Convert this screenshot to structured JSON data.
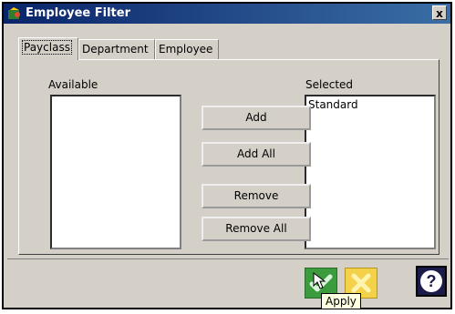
{
  "window": {
    "title": "Employee Filter",
    "close_label": "x",
    "app_icon": "app-icon"
  },
  "tabs": [
    {
      "label": "Payclass",
      "active": true
    },
    {
      "label": "Department",
      "active": false
    },
    {
      "label": "Employee",
      "active": false
    }
  ],
  "available": {
    "label": "Available",
    "items": []
  },
  "selected": {
    "label": "Selected",
    "items": [
      "Standard"
    ]
  },
  "buttons": {
    "add": "Add",
    "add_all": "Add All",
    "remove": "Remove",
    "remove_all": "Remove All"
  },
  "footer": {
    "apply_icon": "check-icon",
    "cancel_icon": "x-icon",
    "help_icon": "help-icon",
    "tooltip": "Apply"
  }
}
